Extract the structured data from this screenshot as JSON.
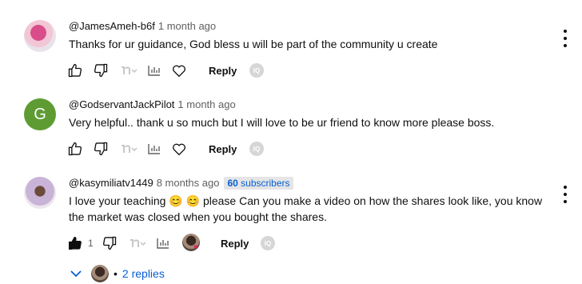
{
  "comments": [
    {
      "author": "@JamesAmeh-b6f",
      "time": "1 month ago",
      "text": "Thanks for ur guidance, God bless u will be part of the community u create",
      "reply_label": "Reply"
    },
    {
      "author": "@GodservantJackPilot",
      "time": "1 month ago",
      "avatar_letter": "G",
      "text": "Very helpful.. thank u so much but I will love to be ur friend to know more please boss.",
      "reply_label": "Reply"
    },
    {
      "author": "@kasymiliatv1449",
      "time": "8 months ago",
      "badge_count": "60",
      "badge_suffix": "subscribers",
      "text_line1": "I love your teaching 😊 😊 please Can you make a video on how the shares look like, you know",
      "text_line2": "the market was closed when you bought the shares.",
      "like_count": "1",
      "reply_label": "Reply",
      "replies_label": "2 replies"
    }
  ],
  "colors": {
    "link_blue": "#065fd4",
    "avatar_green": "#5e9c33",
    "secondary_text": "#606060"
  }
}
